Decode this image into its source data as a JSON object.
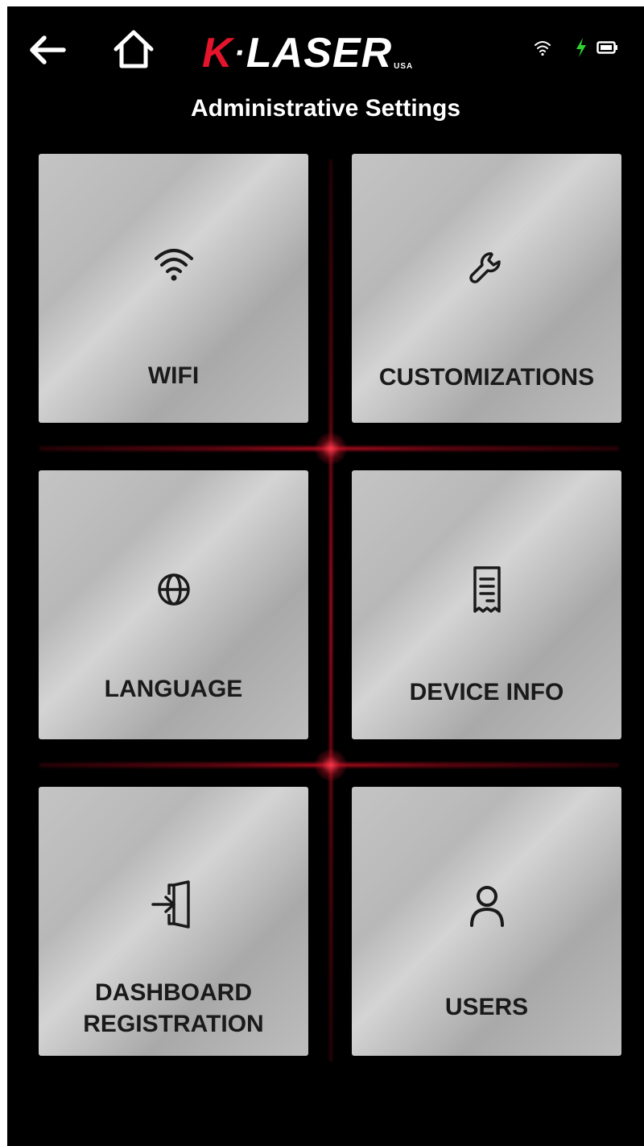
{
  "header": {
    "back_icon": "arrow-left-icon",
    "home_icon": "home-icon",
    "logo": {
      "k": "K",
      "rest": "LASER",
      "suffix": "USA",
      "accent_color": "#e3142b"
    },
    "status": {
      "wifi_icon": "wifi-icon",
      "charging_icon": "lightning-bolt-icon",
      "charging_color": "#2fd12f",
      "battery_icon": "battery-icon"
    }
  },
  "page": {
    "title": "Administrative Settings"
  },
  "tiles": [
    {
      "label": "WIFI",
      "icon": "wifi-icon"
    },
    {
      "label": "CUSTOMIZATIONS",
      "icon": "wrench-icon"
    },
    {
      "label": "LANGUAGE",
      "icon": "globe-icon"
    },
    {
      "label": "DEVICE INFO",
      "icon": "receipt-icon"
    },
    {
      "label_line1": "DASHBOARD",
      "label_line2": "REGISTRATION",
      "icon": "sign-in-icon"
    },
    {
      "label": "USERS",
      "icon": "user-icon"
    }
  ],
  "colors": {
    "background": "#000000",
    "tile": "#bdbdbd",
    "glow": "#e3142b"
  }
}
